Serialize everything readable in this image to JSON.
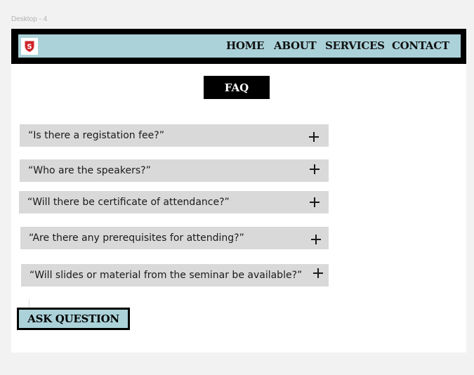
{
  "frame": {
    "label": "Desktop - 4"
  },
  "nav": {
    "logo_letter": "S",
    "links": [
      {
        "label": "HOME"
      },
      {
        "label": "ABOUT"
      },
      {
        "label": "SERVICES"
      },
      {
        "label": "CONTACT"
      }
    ]
  },
  "faq": {
    "title": "FAQ",
    "items": [
      {
        "question": "“Is there a registation fee?”"
      },
      {
        "question": "“Who are the speakers?”"
      },
      {
        "question": "“Will there be certificate of attendance?”"
      },
      {
        "question": "“Are there any prerequisites for attending?”"
      },
      {
        "question": "“Will slides or material from the seminar be  available?”"
      }
    ]
  },
  "ask_button": {
    "label": "ASK QUESTION"
  },
  "colors": {
    "nav_bg": "#abd2d9",
    "nav_border": "#000000",
    "faq_item_bg": "#d9d9d9",
    "logo_red": "#d0232a",
    "page_bg": "#f2f2f2"
  }
}
